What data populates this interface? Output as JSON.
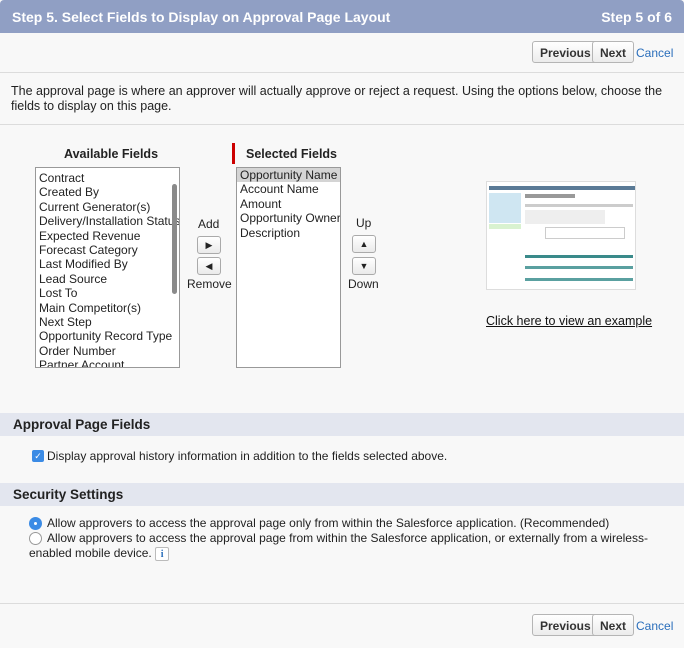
{
  "header": {
    "title": "Step 5. Select Fields to Display on Approval Page Layout",
    "step": "Step 5 of 6"
  },
  "buttons": {
    "previous": "Previous",
    "next": "Next",
    "cancel": "Cancel"
  },
  "description": "The approval page is where an approver will actually approve or reject a request. Using the options below, choose the fields to display on this page.",
  "available": {
    "label": "Available Fields",
    "items": [
      "Contract",
      "Created By",
      "Current Generator(s)",
      "Delivery/Installation Status",
      "Expected Revenue",
      "Forecast Category",
      "Last Modified By",
      "Lead Source",
      "Lost To",
      "Main Competitor(s)",
      "Next Step",
      "Opportunity Record Type",
      "Order Number",
      "Partner Account"
    ]
  },
  "selected": {
    "label": "Selected Fields",
    "items": [
      "Opportunity Name",
      "Account Name",
      "Amount",
      "Opportunity Owner",
      "Description"
    ]
  },
  "move": {
    "add": "Add",
    "remove": "Remove",
    "up": "Up",
    "down": "Down"
  },
  "example_link": "Click here to view an example",
  "approval_fields": {
    "title": "Approval Page Fields",
    "checkbox_label": "Display approval history information in addition to the fields selected above.",
    "checked": true
  },
  "security": {
    "title": "Security Settings",
    "options": [
      "Allow approvers to access the approval page only from within the Salesforce application. (Recommended)",
      "Allow approvers to access the approval page from within the Salesforce application, or externally from a wireless-enabled mobile device."
    ],
    "selected_index": 0,
    "info_icon": "i"
  }
}
